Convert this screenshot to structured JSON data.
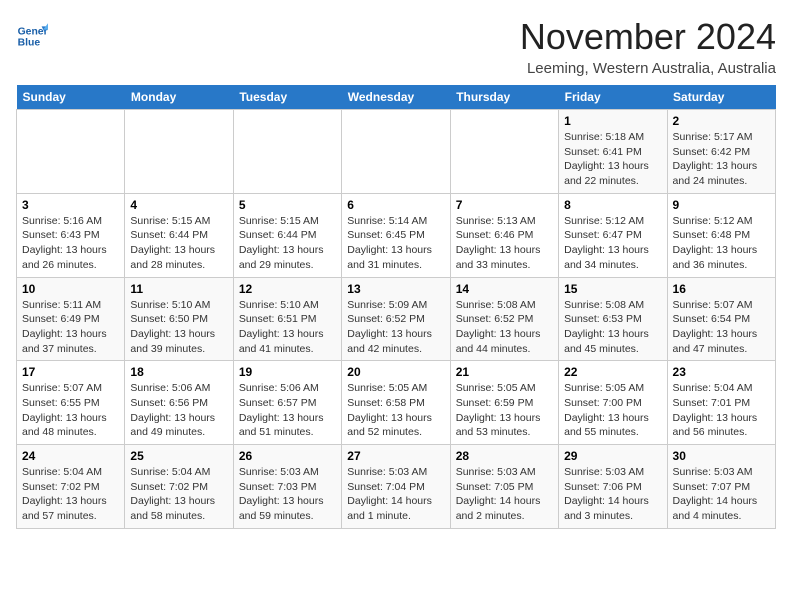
{
  "header": {
    "logo_line1": "General",
    "logo_line2": "Blue",
    "month": "November 2024",
    "location": "Leeming, Western Australia, Australia"
  },
  "weekdays": [
    "Sunday",
    "Monday",
    "Tuesday",
    "Wednesday",
    "Thursday",
    "Friday",
    "Saturday"
  ],
  "weeks": [
    [
      {
        "day": "",
        "info": ""
      },
      {
        "day": "",
        "info": ""
      },
      {
        "day": "",
        "info": ""
      },
      {
        "day": "",
        "info": ""
      },
      {
        "day": "",
        "info": ""
      },
      {
        "day": "1",
        "info": "Sunrise: 5:18 AM\nSunset: 6:41 PM\nDaylight: 13 hours\nand 22 minutes."
      },
      {
        "day": "2",
        "info": "Sunrise: 5:17 AM\nSunset: 6:42 PM\nDaylight: 13 hours\nand 24 minutes."
      }
    ],
    [
      {
        "day": "3",
        "info": "Sunrise: 5:16 AM\nSunset: 6:43 PM\nDaylight: 13 hours\nand 26 minutes."
      },
      {
        "day": "4",
        "info": "Sunrise: 5:15 AM\nSunset: 6:44 PM\nDaylight: 13 hours\nand 28 minutes."
      },
      {
        "day": "5",
        "info": "Sunrise: 5:15 AM\nSunset: 6:44 PM\nDaylight: 13 hours\nand 29 minutes."
      },
      {
        "day": "6",
        "info": "Sunrise: 5:14 AM\nSunset: 6:45 PM\nDaylight: 13 hours\nand 31 minutes."
      },
      {
        "day": "7",
        "info": "Sunrise: 5:13 AM\nSunset: 6:46 PM\nDaylight: 13 hours\nand 33 minutes."
      },
      {
        "day": "8",
        "info": "Sunrise: 5:12 AM\nSunset: 6:47 PM\nDaylight: 13 hours\nand 34 minutes."
      },
      {
        "day": "9",
        "info": "Sunrise: 5:12 AM\nSunset: 6:48 PM\nDaylight: 13 hours\nand 36 minutes."
      }
    ],
    [
      {
        "day": "10",
        "info": "Sunrise: 5:11 AM\nSunset: 6:49 PM\nDaylight: 13 hours\nand 37 minutes."
      },
      {
        "day": "11",
        "info": "Sunrise: 5:10 AM\nSunset: 6:50 PM\nDaylight: 13 hours\nand 39 minutes."
      },
      {
        "day": "12",
        "info": "Sunrise: 5:10 AM\nSunset: 6:51 PM\nDaylight: 13 hours\nand 41 minutes."
      },
      {
        "day": "13",
        "info": "Sunrise: 5:09 AM\nSunset: 6:52 PM\nDaylight: 13 hours\nand 42 minutes."
      },
      {
        "day": "14",
        "info": "Sunrise: 5:08 AM\nSunset: 6:52 PM\nDaylight: 13 hours\nand 44 minutes."
      },
      {
        "day": "15",
        "info": "Sunrise: 5:08 AM\nSunset: 6:53 PM\nDaylight: 13 hours\nand 45 minutes."
      },
      {
        "day": "16",
        "info": "Sunrise: 5:07 AM\nSunset: 6:54 PM\nDaylight: 13 hours\nand 47 minutes."
      }
    ],
    [
      {
        "day": "17",
        "info": "Sunrise: 5:07 AM\nSunset: 6:55 PM\nDaylight: 13 hours\nand 48 minutes."
      },
      {
        "day": "18",
        "info": "Sunrise: 5:06 AM\nSunset: 6:56 PM\nDaylight: 13 hours\nand 49 minutes."
      },
      {
        "day": "19",
        "info": "Sunrise: 5:06 AM\nSunset: 6:57 PM\nDaylight: 13 hours\nand 51 minutes."
      },
      {
        "day": "20",
        "info": "Sunrise: 5:05 AM\nSunset: 6:58 PM\nDaylight: 13 hours\nand 52 minutes."
      },
      {
        "day": "21",
        "info": "Sunrise: 5:05 AM\nSunset: 6:59 PM\nDaylight: 13 hours\nand 53 minutes."
      },
      {
        "day": "22",
        "info": "Sunrise: 5:05 AM\nSunset: 7:00 PM\nDaylight: 13 hours\nand 55 minutes."
      },
      {
        "day": "23",
        "info": "Sunrise: 5:04 AM\nSunset: 7:01 PM\nDaylight: 13 hours\nand 56 minutes."
      }
    ],
    [
      {
        "day": "24",
        "info": "Sunrise: 5:04 AM\nSunset: 7:02 PM\nDaylight: 13 hours\nand 57 minutes."
      },
      {
        "day": "25",
        "info": "Sunrise: 5:04 AM\nSunset: 7:02 PM\nDaylight: 13 hours\nand 58 minutes."
      },
      {
        "day": "26",
        "info": "Sunrise: 5:03 AM\nSunset: 7:03 PM\nDaylight: 13 hours\nand 59 minutes."
      },
      {
        "day": "27",
        "info": "Sunrise: 5:03 AM\nSunset: 7:04 PM\nDaylight: 14 hours\nand 1 minute."
      },
      {
        "day": "28",
        "info": "Sunrise: 5:03 AM\nSunset: 7:05 PM\nDaylight: 14 hours\nand 2 minutes."
      },
      {
        "day": "29",
        "info": "Sunrise: 5:03 AM\nSunset: 7:06 PM\nDaylight: 14 hours\nand 3 minutes."
      },
      {
        "day": "30",
        "info": "Sunrise: 5:03 AM\nSunset: 7:07 PM\nDaylight: 14 hours\nand 4 minutes."
      }
    ]
  ]
}
